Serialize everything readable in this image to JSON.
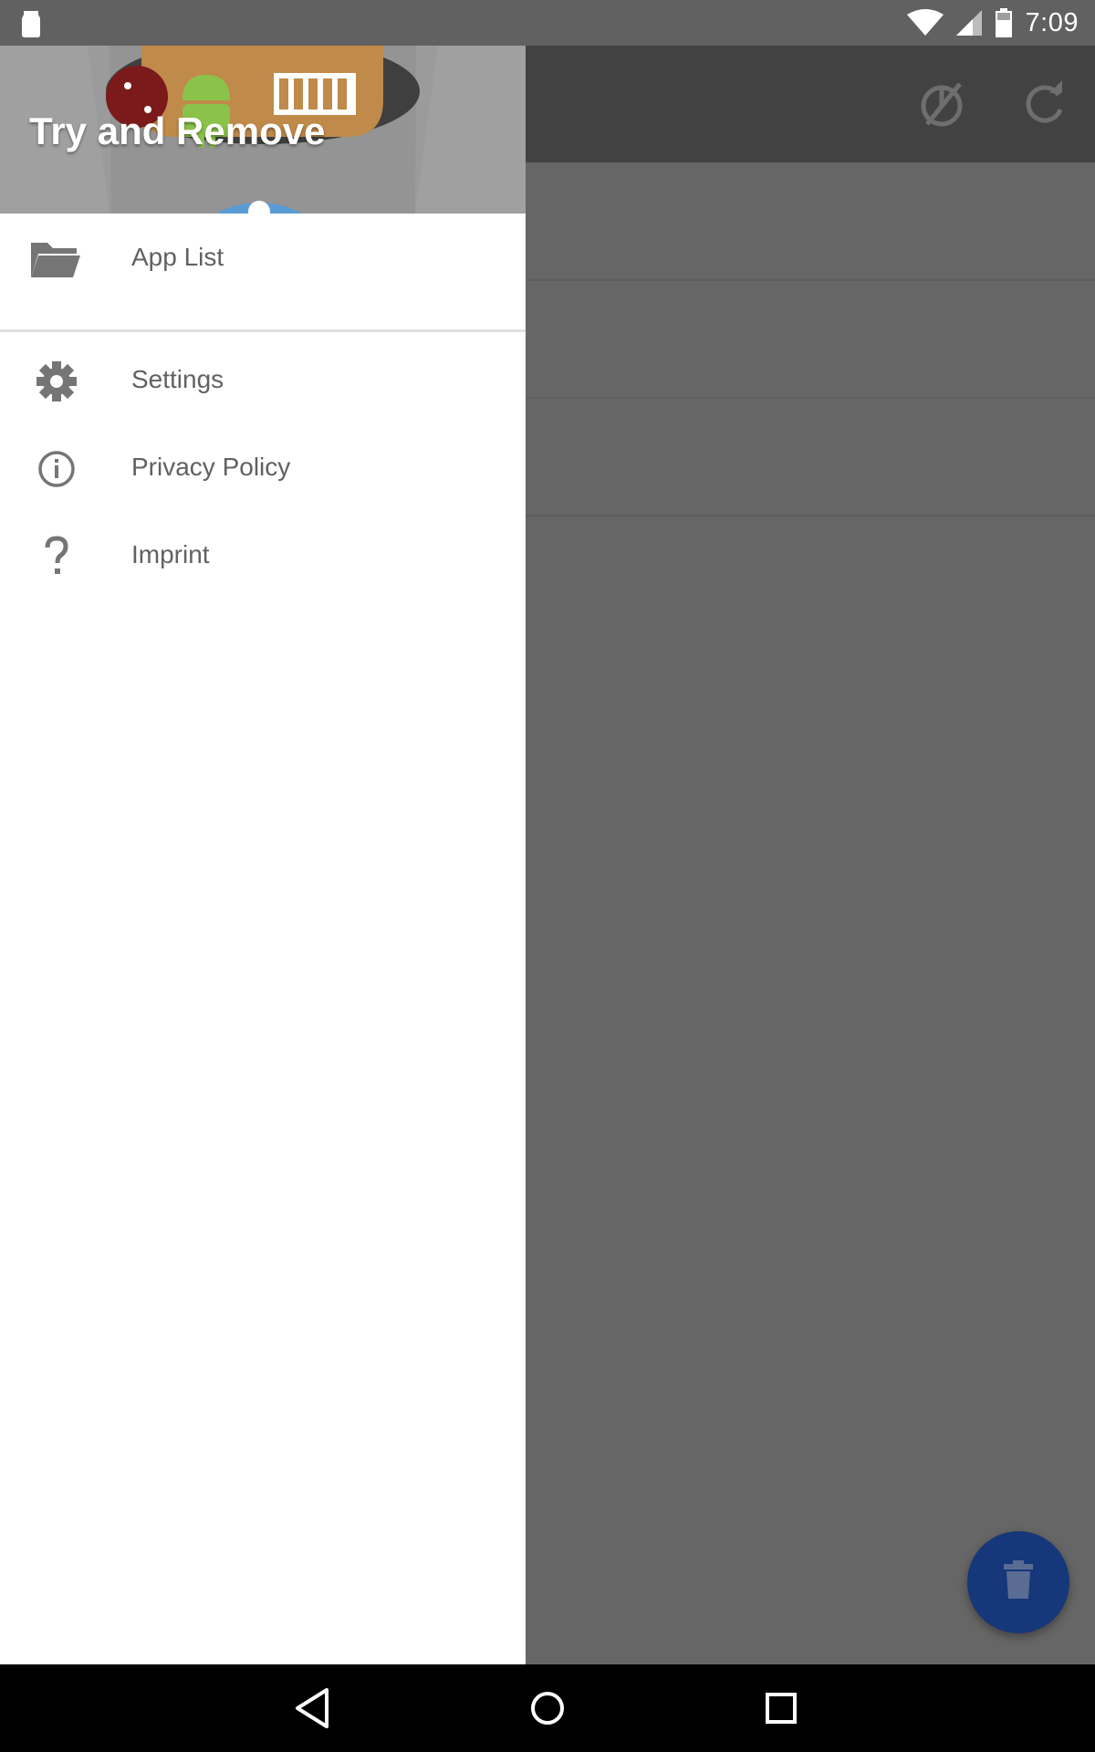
{
  "status_bar": {
    "time": "7:09",
    "icons": [
      "app-notification-icon",
      "wifi-icon",
      "cell-signal-icon",
      "battery-icon"
    ]
  },
  "app": {
    "toolbar_icons": [
      "timer-off-icon",
      "refresh-icon"
    ],
    "fab_icon": "trash-icon",
    "fab_color": "#163779"
  },
  "drawer": {
    "header_title": "Try and Remove",
    "items": [
      {
        "label": "App List",
        "icon": "folder-icon"
      },
      {
        "label": "Settings",
        "icon": "gear-icon"
      },
      {
        "label": "Privacy Policy",
        "icon": "info-icon"
      },
      {
        "label": "Imprint",
        "icon": "question-icon"
      }
    ]
  },
  "nav_bar": {
    "buttons": [
      "back-icon",
      "home-icon",
      "recents-icon"
    ]
  }
}
